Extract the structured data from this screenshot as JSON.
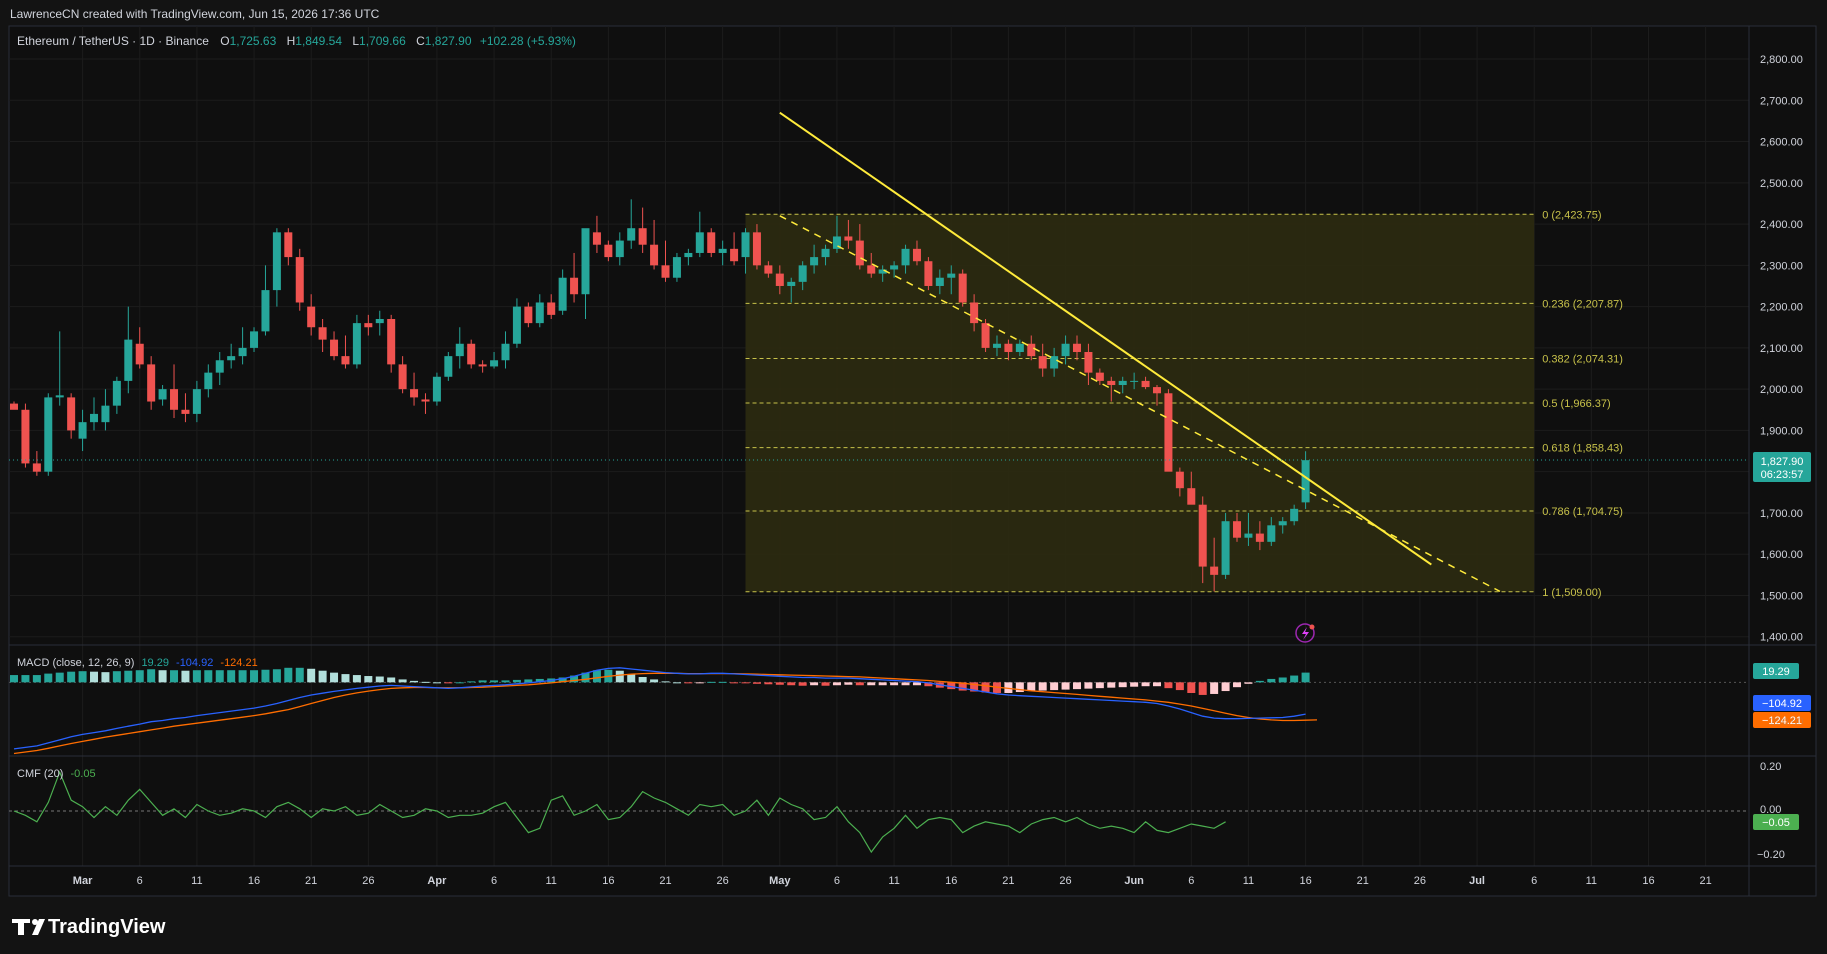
{
  "header": {
    "credit": "LawrenceCN created with TradingView.com, Jun 15, 2026 17:36 UTC"
  },
  "legend": {
    "symbol": "Ethereum / TetherUS · 1D · Binance",
    "o_label": "O",
    "o": "1,725.63",
    "h_label": "H",
    "h": "1,849.54",
    "l_label": "L",
    "l": "1,709.66",
    "c_label": "C",
    "c": "1,827.90",
    "change": "+102.28 (+5.93%)"
  },
  "price_tag": {
    "price": "1,827.90",
    "countdown": "06:23:57"
  },
  "macd": {
    "label": "MACD (close, 12, 26, 9)",
    "hist": "19.29",
    "macd": "-104.92",
    "signal": "-124.21",
    "hist_tag": "19.29",
    "macd_tag": "−104.92",
    "signal_tag": "−124.21",
    "partial_tick": "200.00"
  },
  "cmf": {
    "label": "CMF (20)",
    "value": "-0.05",
    "tag": "−0.05",
    "ticks": [
      "0.20",
      "0.00",
      "−0.20"
    ]
  },
  "footer": {
    "brand": "TradingView"
  },
  "colors": {
    "up": "#26a69a",
    "down": "#ef5350",
    "trend": "#ffeb3b",
    "fib": "#c8c24a",
    "fib_fill": "#2c2b11",
    "macd_line": "#2962ff",
    "signal_line": "#ff6d00",
    "cmf_line": "#4caf50",
    "background": "#131313",
    "text": "#d1d4dc",
    "label_green": "#26a69a"
  },
  "chart_data": {
    "type": "candlestick",
    "symbol": "ETH/USDT",
    "timeframe": "1D",
    "ylim": [
      1380,
      2880
    ],
    "y_ticks": [
      "2,800.00",
      "2,700.00",
      "2,600.00",
      "2,500.00",
      "2,400.00",
      "2,300.00",
      "2,200.00",
      "2,100.00",
      "2,000.00",
      "1,900.00",
      "1,800.00",
      "1,700.00",
      "1,600.00",
      "1,500.00",
      "1,400.00"
    ],
    "x_ticks": [
      {
        "label": "Mar",
        "day": 6
      },
      {
        "label": "6",
        "day": 11
      },
      {
        "label": "11",
        "day": 16
      },
      {
        "label": "16",
        "day": 21
      },
      {
        "label": "21",
        "day": 26
      },
      {
        "label": "26",
        "day": 31
      },
      {
        "label": "Apr",
        "day": 37
      },
      {
        "label": "6",
        "day": 42
      },
      {
        "label": "11",
        "day": 47
      },
      {
        "label": "16",
        "day": 52
      },
      {
        "label": "21",
        "day": 57
      },
      {
        "label": "26",
        "day": 62
      },
      {
        "label": "May",
        "day": 67
      },
      {
        "label": "6",
        "day": 72
      },
      {
        "label": "11",
        "day": 77
      },
      {
        "label": "16",
        "day": 82
      },
      {
        "label": "21",
        "day": 87
      },
      {
        "label": "26",
        "day": 92
      },
      {
        "label": "Jun",
        "day": 98
      },
      {
        "label": "6",
        "day": 103
      },
      {
        "label": "11",
        "day": 108
      },
      {
        "label": "16",
        "day": 113
      },
      {
        "label": "21",
        "day": 118
      },
      {
        "label": "26",
        "day": 123
      },
      {
        "label": "Jul",
        "day": 128
      },
      {
        "label": "6",
        "day": 133
      },
      {
        "label": "11",
        "day": 138
      },
      {
        "label": "16",
        "day": 143
      },
      {
        "label": "21",
        "day": 148
      }
    ],
    "candles": [
      [
        1965,
        1970,
        1955,
        1950
      ],
      [
        1950,
        1965,
        1810,
        1820
      ],
      [
        1820,
        1850,
        1790,
        1800
      ],
      [
        1800,
        1990,
        1790,
        1980
      ],
      [
        1980,
        2140,
        1960,
        1985
      ],
      [
        1980,
        1990,
        1880,
        1900
      ],
      [
        1880,
        1950,
        1850,
        1920
      ],
      [
        1920,
        1980,
        1900,
        1940
      ],
      [
        1920,
        2000,
        1900,
        1960
      ],
      [
        1960,
        2030,
        1940,
        2020
      ],
      [
        2020,
        2200,
        1990,
        2120
      ],
      [
        2110,
        2150,
        2050,
        2060
      ],
      [
        2060,
        2080,
        1950,
        1970
      ],
      [
        1975,
        2010,
        1960,
        2000
      ],
      [
        2000,
        2060,
        1930,
        1950
      ],
      [
        1950,
        1990,
        1920,
        1940
      ],
      [
        1940,
        2020,
        1920,
        2000
      ],
      [
        2000,
        2060,
        1980,
        2040
      ],
      [
        2040,
        2090,
        2010,
        2070
      ],
      [
        2070,
        2110,
        2050,
        2080
      ],
      [
        2080,
        2150,
        2060,
        2100
      ],
      [
        2100,
        2150,
        2090,
        2140
      ],
      [
        2140,
        2300,
        2130,
        2240
      ],
      [
        2240,
        2390,
        2200,
        2380
      ],
      [
        2380,
        2390,
        2300,
        2320
      ],
      [
        2320,
        2340,
        2190,
        2210
      ],
      [
        2200,
        2230,
        2130,
        2150
      ],
      [
        2150,
        2170,
        2090,
        2120
      ],
      [
        2120,
        2140,
        2070,
        2080
      ],
      [
        2080,
        2130,
        2050,
        2060
      ],
      [
        2060,
        2180,
        2050,
        2160
      ],
      [
        2160,
        2180,
        2130,
        2150
      ],
      [
        2160,
        2190,
        2130,
        2170
      ],
      [
        2170,
        2180,
        2040,
        2060
      ],
      [
        2060,
        2080,
        1990,
        2000
      ],
      [
        2000,
        2040,
        1960,
        1980
      ],
      [
        1975,
        1990,
        1940,
        1970
      ],
      [
        1970,
        2040,
        1960,
        2030
      ],
      [
        2030,
        2090,
        2020,
        2080
      ],
      [
        2080,
        2150,
        2050,
        2110
      ],
      [
        2110,
        2120,
        2050,
        2060
      ],
      [
        2060,
        2070,
        2040,
        2055
      ],
      [
        2055,
        2090,
        2050,
        2070
      ],
      [
        2070,
        2140,
        2050,
        2110
      ],
      [
        2110,
        2220,
        2100,
        2200
      ],
      [
        2200,
        2210,
        2150,
        2160
      ],
      [
        2160,
        2230,
        2150,
        2210
      ],
      [
        2210,
        2230,
        2170,
        2180
      ],
      [
        2190,
        2290,
        2180,
        2270
      ],
      [
        2270,
        2330,
        2210,
        2230
      ],
      [
        2230,
        2380,
        2170,
        2390
      ],
      [
        2380,
        2420,
        2330,
        2350
      ],
      [
        2350,
        2360,
        2310,
        2320
      ],
      [
        2320,
        2380,
        2300,
        2360
      ],
      [
        2360,
        2460,
        2340,
        2390
      ],
      [
        2390,
        2440,
        2330,
        2350
      ],
      [
        2350,
        2410,
        2290,
        2300
      ],
      [
        2300,
        2360,
        2260,
        2270
      ],
      [
        2270,
        2330,
        2260,
        2320
      ],
      [
        2320,
        2340,
        2300,
        2330
      ],
      [
        2330,
        2430,
        2320,
        2380
      ],
      [
        2380,
        2390,
        2320,
        2330
      ],
      [
        2330,
        2360,
        2300,
        2340
      ],
      [
        2340,
        2380,
        2300,
        2310
      ],
      [
        2320,
        2390,
        2280,
        2380
      ],
      [
        2380,
        2400,
        2290,
        2300
      ],
      [
        2300,
        2310,
        2270,
        2280
      ],
      [
        2280,
        2300,
        2230,
        2250
      ],
      [
        2250,
        2270,
        2210,
        2260
      ],
      [
        2260,
        2310,
        2240,
        2300
      ],
      [
        2300,
        2350,
        2280,
        2320
      ],
      [
        2320,
        2350,
        2300,
        2340
      ],
      [
        2340,
        2420,
        2330,
        2370
      ],
      [
        2370,
        2410,
        2340,
        2360
      ],
      [
        2360,
        2400,
        2290,
        2300
      ],
      [
        2300,
        2330,
        2270,
        2280
      ],
      [
        2280,
        2300,
        2260,
        2290
      ],
      [
        2290,
        2310,
        2270,
        2300
      ],
      [
        2300,
        2350,
        2280,
        2340
      ],
      [
        2340,
        2360,
        2300,
        2310
      ],
      [
        2310,
        2320,
        2240,
        2250
      ],
      [
        2250,
        2290,
        2230,
        2270
      ],
      [
        2270,
        2300,
        2230,
        2280
      ],
      [
        2280,
        2290,
        2200,
        2210
      ],
      [
        2210,
        2230,
        2140,
        2160
      ],
      [
        2160,
        2170,
        2090,
        2100
      ],
      [
        2100,
        2130,
        2080,
        2110
      ],
      [
        2110,
        2120,
        2070,
        2090
      ],
      [
        2090,
        2120,
        2080,
        2110
      ],
      [
        2110,
        2130,
        2070,
        2080
      ],
      [
        2080,
        2110,
        2030,
        2050
      ],
      [
        2050,
        2100,
        2030,
        2080
      ],
      [
        2080,
        2130,
        2060,
        2110
      ],
      [
        2110,
        2130,
        2070,
        2090
      ],
      [
        2090,
        2110,
        2010,
        2040
      ],
      [
        2040,
        2050,
        2010,
        2020
      ],
      [
        2020,
        2030,
        1970,
        2010
      ],
      [
        2010,
        2030,
        1990,
        2020
      ],
      [
        2020,
        2040,
        2000,
        2020
      ],
      [
        2020,
        2030,
        2000,
        2005
      ],
      [
        2005,
        2010,
        1960,
        1990
      ],
      [
        1990,
        2000,
        1880,
        1800
      ],
      [
        1800,
        1810,
        1740,
        1760
      ],
      [
        1760,
        1800,
        1750,
        1720
      ],
      [
        1720,
        1740,
        1530,
        1570
      ],
      [
        1570,
        1640,
        1510,
        1550
      ],
      [
        1550,
        1700,
        1540,
        1680
      ],
      [
        1680,
        1700,
        1630,
        1640
      ],
      [
        1640,
        1700,
        1620,
        1650
      ],
      [
        1650,
        1680,
        1610,
        1630
      ],
      [
        1630,
        1690,
        1620,
        1670
      ],
      [
        1670,
        1690,
        1650,
        1680
      ],
      [
        1680,
        1720,
        1670,
        1710
      ],
      [
        1725.63,
        1849.54,
        1709.66,
        1827.9
      ]
    ],
    "trendline": {
      "from": {
        "day": 67,
        "price": 2670
      },
      "to": {
        "day": 124,
        "price": 1575
      }
    },
    "dashed_channel": {
      "from": {
        "day": 67,
        "price": 2420
      },
      "to": {
        "day": 130,
        "price": 1510
      }
    },
    "fib_box": {
      "from_day": 64,
      "to_day": 133
    },
    "fib_levels": [
      {
        "label": "0 (2,423.75)",
        "ratio": 0,
        "price": 2423.75
      },
      {
        "label": "0.236 (2,207.87)",
        "ratio": 0.236,
        "price": 2207.87
      },
      {
        "label": "0.382 (2,074.31)",
        "ratio": 0.382,
        "price": 2074.31
      },
      {
        "label": "0.5 (1,966.37)",
        "ratio": 0.5,
        "price": 1966.37
      },
      {
        "label": "0.618 (1,858.43)",
        "ratio": 0.618,
        "price": 1858.43
      },
      {
        "label": "0.786 (1,704.75)",
        "ratio": 0.786,
        "price": 1704.75
      },
      {
        "label": "1 (1,509.00)",
        "ratio": 1,
        "price": 1509
      }
    ],
    "macd_ylim": [
      -240,
      120
    ],
    "macd_series": [
      -220,
      -215,
      -210,
      -200,
      -190,
      -180,
      -172,
      -166,
      -160,
      -152,
      -145,
      -138,
      -130,
      -126,
      -120,
      -116,
      -110,
      -105,
      -100,
      -95,
      -90,
      -85,
      -78,
      -70,
      -60,
      -50,
      -42,
      -36,
      -30,
      -25,
      -20,
      -16,
      -12,
      -10,
      -12,
      -14,
      -16,
      -18,
      -20,
      -18,
      -15,
      -12,
      -10,
      -8,
      -5,
      -2,
      2,
      6,
      12,
      20,
      30,
      40,
      46,
      48,
      44,
      40,
      36,
      32,
      30,
      28,
      28,
      30,
      30,
      28,
      26,
      24,
      22,
      20,
      18,
      16,
      16,
      14,
      14,
      14,
      12,
      10,
      8,
      6,
      4,
      2,
      -2,
      -8,
      -14,
      -20,
      -26,
      -32,
      -38,
      -42,
      -44,
      -46,
      -48,
      -50,
      -52,
      -54,
      -56,
      -58,
      -60,
      -62,
      -64,
      -66,
      -70,
      -78,
      -88,
      -100,
      -112,
      -118,
      -120,
      -120,
      -119,
      -118,
      -117,
      -116,
      -112,
      -104.92
    ],
    "signal_series": [
      -235,
      -230,
      -225,
      -218,
      -210,
      -202,
      -195,
      -188,
      -181,
      -175,
      -169,
      -163,
      -157,
      -151,
      -145,
      -140,
      -135,
      -130,
      -125,
      -120,
      -115,
      -110,
      -104,
      -97,
      -90,
      -80,
      -70,
      -60,
      -50,
      -42,
      -35,
      -29,
      -24,
      -20,
      -18,
      -17,
      -17,
      -18,
      -18,
      -18,
      -17,
      -16,
      -14,
      -12,
      -10,
      -8,
      -5,
      -2,
      2,
      6,
      10,
      15,
      20,
      24,
      27,
      29,
      30,
      30,
      30,
      29,
      29,
      29,
      29,
      29,
      28,
      27,
      26,
      25,
      24,
      23,
      22,
      21,
      20,
      19,
      18,
      16,
      14,
      12,
      10,
      8,
      6,
      3,
      0,
      -3,
      -7,
      -11,
      -16,
      -20,
      -24,
      -28,
      -31,
      -34,
      -37,
      -40,
      -43,
      -46,
      -49,
      -52,
      -55,
      -58,
      -62,
      -66,
      -72,
      -78,
      -86,
      -94,
      -102,
      -110,
      -116,
      -121,
      -124,
      -126,
      -126,
      -125,
      -124.21
    ],
    "cmf_ylim": [
      -0.25,
      0.25
    ],
    "cmf_series": [
      0.0,
      -0.02,
      -0.05,
      0.04,
      0.18,
      0.05,
      0.02,
      -0.03,
      0.02,
      -0.02,
      0.05,
      0.1,
      0.04,
      -0.02,
      0.01,
      -0.03,
      0.03,
      0.0,
      -0.02,
      -0.01,
      0.01,
      0.0,
      -0.03,
      0.02,
      0.04,
      0.01,
      -0.03,
      0.01,
      0.0,
      0.02,
      -0.02,
      -0.01,
      0.03,
      0.0,
      -0.03,
      -0.02,
      0.01,
      0.0,
      -0.03,
      -0.02,
      -0.02,
      -0.01,
      0.02,
      0.04,
      -0.03,
      -0.1,
      -0.08,
      0.05,
      0.07,
      -0.02,
      0.0,
      0.03,
      -0.04,
      -0.03,
      0.02,
      0.09,
      0.06,
      0.04,
      0.01,
      -0.02,
      0.03,
      0.02,
      0.03,
      -0.02,
      0.0,
      0.05,
      -0.02,
      0.06,
      0.03,
      0.01,
      -0.04,
      -0.03,
      0.02,
      -0.05,
      -0.1,
      -0.19,
      -0.12,
      -0.08,
      -0.02,
      -0.08,
      -0.04,
      -0.03,
      -0.04,
      -0.1,
      -0.07,
      -0.05,
      -0.06,
      -0.07,
      -0.1,
      -0.06,
      -0.04,
      -0.03,
      -0.05,
      -0.03,
      -0.06,
      -0.08,
      -0.07,
      -0.08,
      -0.1,
      -0.05,
      -0.09,
      -0.1,
      -0.08,
      -0.06,
      -0.07,
      -0.08,
      -0.05
    ]
  }
}
